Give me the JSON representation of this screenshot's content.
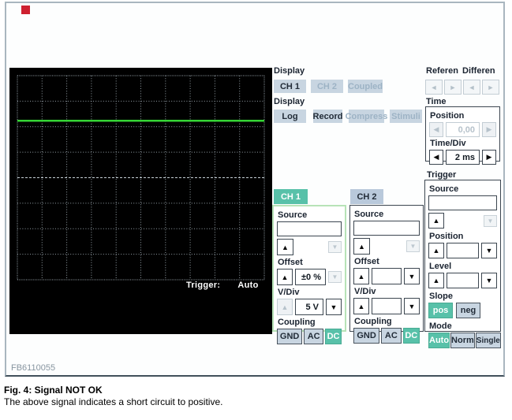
{
  "icons": {
    "up": "▲",
    "down": "▼",
    "left": "◀",
    "right": "▶",
    "chevron_left": "◄",
    "chevron_right": "►"
  },
  "colors": {
    "accent_teal": "#58c1a9",
    "button_blue": "#c8d5e1",
    "trace_green": "#35d435",
    "screen_black": "#000000"
  },
  "scope": {
    "grid": {
      "cols": 10,
      "rows": 8
    },
    "trace_y_fraction": 0.221,
    "status": {
      "label": "Trigger:",
      "value": "Auto"
    }
  },
  "display_channels": {
    "label": "Display",
    "buttons": [
      {
        "label": "CH 1",
        "state": "active"
      },
      {
        "label": "CH 2",
        "state": "disabled"
      },
      {
        "label": "Coupled",
        "state": "disabled"
      }
    ]
  },
  "display_modes": {
    "label": "Display",
    "buttons": [
      {
        "label": "Log",
        "state": "active"
      },
      {
        "label": "Record",
        "state": "active"
      },
      {
        "label": "Compress",
        "state": "disabled"
      },
      {
        "label": "Stimuli",
        "state": "disabled"
      }
    ]
  },
  "reference": {
    "label": "Referen"
  },
  "differential": {
    "label": "Differen"
  },
  "time": {
    "label": "Time",
    "position_label": "Position",
    "position_value": "0,00",
    "timediv_label": "Time/Div",
    "timediv_value": "2 ms"
  },
  "trigger": {
    "label": "Trigger",
    "source_label": "Source",
    "source_value": "",
    "position_label": "Position",
    "position_value": "",
    "level_label": "Level",
    "level_value": "",
    "slope_label": "Slope",
    "slope_buttons": [
      {
        "label": "pos",
        "state": "active"
      },
      {
        "label": "neg",
        "state": "inactive"
      }
    ],
    "mode_label": "Mode",
    "mode_buttons": [
      {
        "label": "Auto",
        "state": "active"
      },
      {
        "label": "Norm",
        "state": "inactive"
      },
      {
        "label": "Single",
        "state": "inactive"
      }
    ]
  },
  "ch1": {
    "tab": "CH 1",
    "source_label": "Source",
    "source_value": "",
    "offset_label": "Offset",
    "offset_value": "±0 %",
    "vdiv_label": "V/Div",
    "vdiv_value": "5 V",
    "coupling_label": "Coupling",
    "coupling_buttons": [
      {
        "label": "GND",
        "state": "inactive"
      },
      {
        "label": "AC",
        "state": "inactive"
      },
      {
        "label": "DC",
        "state": "active"
      }
    ]
  },
  "ch2": {
    "tab": "CH 2",
    "source_label": "Source",
    "source_value": "",
    "offset_label": "Offset",
    "offset_value": "",
    "vdiv_label": "V/Div",
    "vdiv_value": "",
    "coupling_label": "Coupling",
    "coupling_buttons": [
      {
        "label": "GND",
        "state": "inactive"
      },
      {
        "label": "AC",
        "state": "inactive"
      },
      {
        "label": "DC",
        "state": "active"
      }
    ]
  },
  "footer": {
    "figure_number": "FB6110055"
  },
  "caption": {
    "title": "Fig. 4: Signal NOT OK",
    "subtitle": "The above signal indicates a short circuit to positive."
  }
}
